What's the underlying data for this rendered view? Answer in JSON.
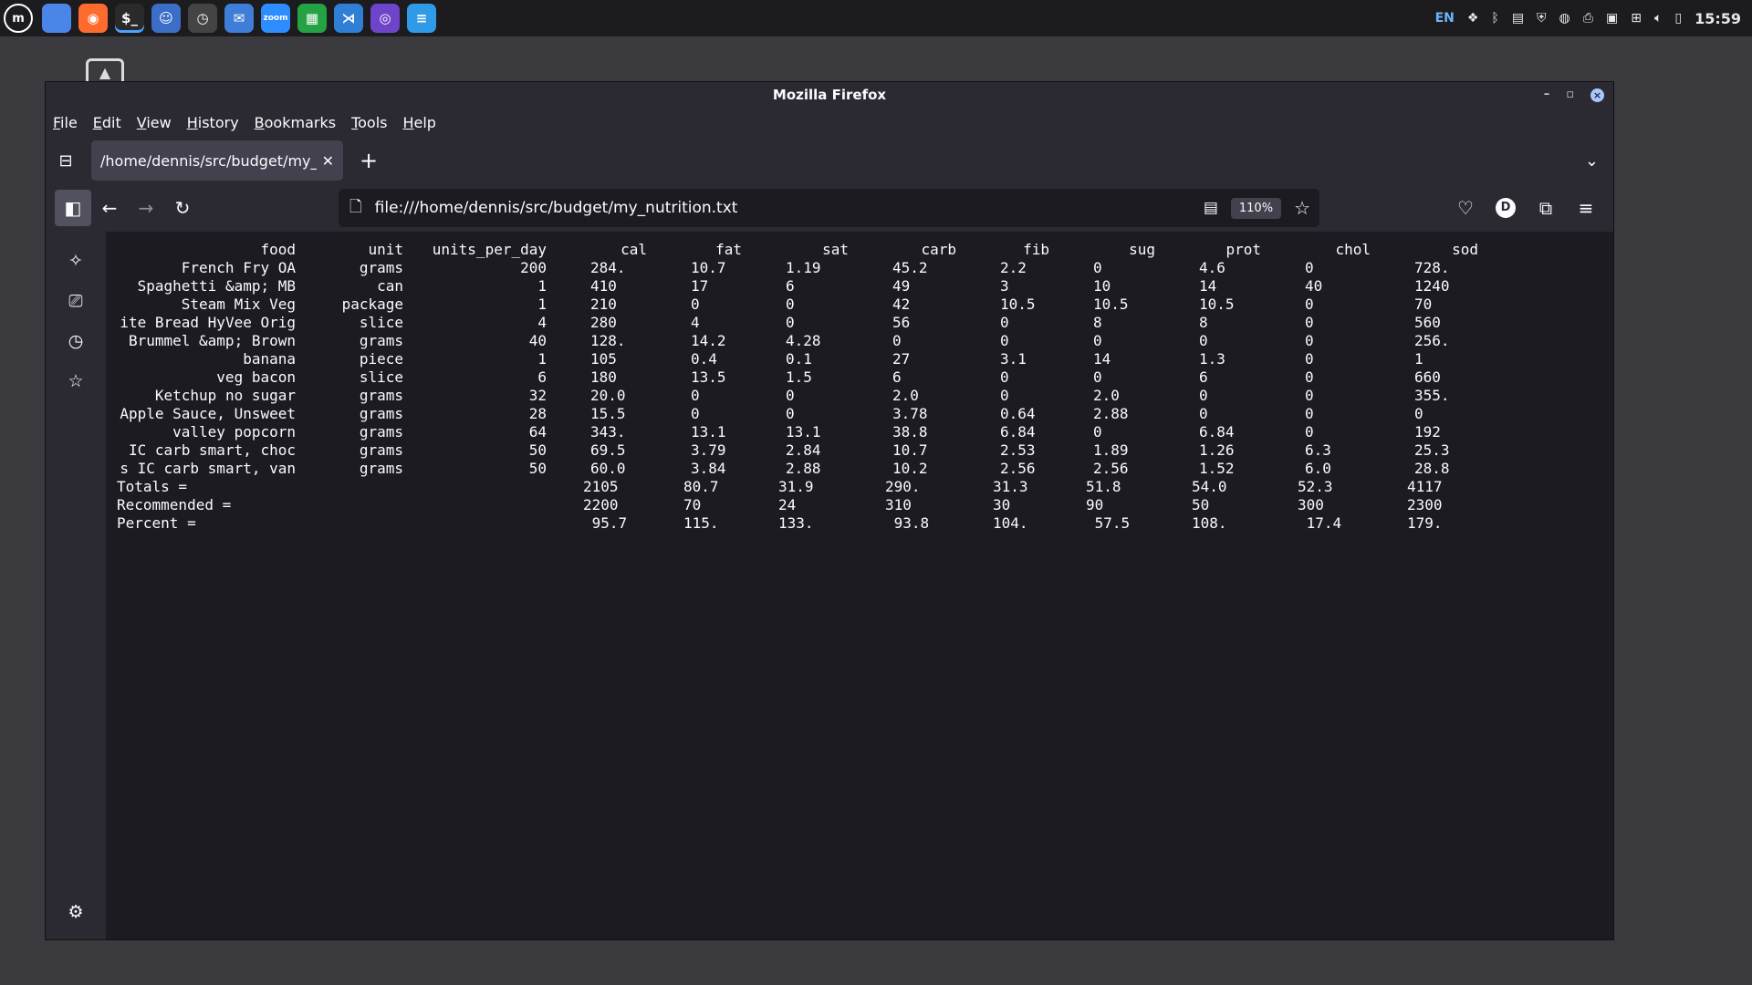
{
  "panel": {
    "menu_logo": "m",
    "launchers": [
      {
        "name": "files-icon",
        "color": "#4a86e8",
        "glyph": ""
      },
      {
        "name": "firefox-icon",
        "color": "#ff6b2d",
        "glyph": "◉"
      },
      {
        "name": "terminal-icon",
        "color": "#2a2a2a",
        "glyph": "$_"
      },
      {
        "name": "finder-icon",
        "color": "#3c6ec8",
        "glyph": "☺"
      },
      {
        "name": "timeshift-icon",
        "color": "#444444",
        "glyph": "◷"
      },
      {
        "name": "mail-icon",
        "color": "#3f7ed8",
        "glyph": "✉"
      },
      {
        "name": "zoom-icon",
        "color": "#2d8cff",
        "glyph": "zoom"
      },
      {
        "name": "spreadsheet-icon",
        "color": "#25a244",
        "glyph": "▦"
      },
      {
        "name": "vscode-icon",
        "color": "#2f7fd6",
        "glyph": "⋊"
      },
      {
        "name": "github-icon",
        "color": "#6e44c8",
        "glyph": "◎"
      },
      {
        "name": "text-editor-icon",
        "color": "#2f9be8",
        "glyph": "≡"
      }
    ],
    "tray": {
      "language": "EN",
      "clock": "15:59"
    }
  },
  "window": {
    "title": "Mozilla Firefox",
    "menu": [
      {
        "mnemonic": "F",
        "rest": "ile"
      },
      {
        "mnemonic": "E",
        "rest": "dit"
      },
      {
        "mnemonic": "V",
        "rest": "iew"
      },
      {
        "mnemonic": "H",
        "rest": "istory"
      },
      {
        "mnemonic": "B",
        "rest": "ookmarks"
      },
      {
        "mnemonic": "T",
        "rest": "ools"
      },
      {
        "mnemonic": "H",
        "rest": "elp"
      }
    ],
    "tab": {
      "title": "/home/dennis/src/budget/my_nutrition.txt"
    },
    "url": "file:///home/dennis/src/budget/my_nutrition.txt",
    "zoom": "110%",
    "avatar_letter": "D"
  },
  "nutrition": {
    "headers": [
      "food",
      "unit",
      "units_per_day",
      "cal",
      "fat",
      "sat",
      "carb",
      "fib",
      "sug",
      "prot",
      "chol",
      "sod"
    ],
    "rows": [
      [
        "French Fry OA",
        "grams",
        "200",
        "284.",
        "10.7",
        "1.19",
        "45.2",
        "2.2",
        "0",
        "4.6",
        "0",
        "728."
      ],
      [
        "Spaghetti &amp; MB",
        "can",
        "1",
        "410",
        "17",
        "6",
        "49",
        "3",
        "10",
        "14",
        "40",
        "1240"
      ],
      [
        "Steam Mix Veg",
        "package",
        "1",
        "210",
        "0",
        "0",
        "42",
        "10.5",
        "10.5",
        "10.5",
        "0",
        "70"
      ],
      [
        "ite Bread HyVee Orig",
        "slice",
        "4",
        "280",
        "4",
        "0",
        "56",
        "0",
        "8",
        "8",
        "0",
        "560"
      ],
      [
        "Brummel &amp; Brown",
        "grams",
        "40",
        "128.",
        "14.2",
        "4.28",
        "0",
        "0",
        "0",
        "0",
        "0",
        "256."
      ],
      [
        "banana",
        "piece",
        "1",
        "105",
        "0.4",
        "0.1",
        "27",
        "3.1",
        "14",
        "1.3",
        "0",
        "1"
      ],
      [
        "veg bacon",
        "slice",
        "6",
        "180",
        "13.5",
        "1.5",
        "6",
        "0",
        "0",
        "6",
        "0",
        "660"
      ],
      [
        "Ketchup no sugar",
        "grams",
        "32",
        "20.0",
        "0",
        "0",
        "2.0",
        "0",
        "2.0",
        "0",
        "0",
        "355."
      ],
      [
        "Apple Sauce, Unsweet",
        "grams",
        "28",
        "15.5",
        "0",
        "0",
        "3.78",
        "0.64",
        "2.88",
        "0",
        "0",
        "0"
      ],
      [
        "valley popcorn",
        "grams",
        "64",
        "343.",
        "13.1",
        "13.1",
        "38.8",
        "6.84",
        "0",
        "6.84",
        "0",
        "192"
      ],
      [
        "IC carb smart, choc",
        "grams",
        "50",
        "69.5",
        "3.79",
        "2.84",
        "10.7",
        "2.53",
        "1.89",
        "1.26",
        "6.3",
        "25.3"
      ],
      [
        "s IC carb smart, van",
        "grams",
        "50",
        "60.0",
        "3.84",
        "2.88",
        "10.2",
        "2.56",
        "2.56",
        "1.52",
        "6.0",
        "28.8"
      ]
    ],
    "summary": [
      {
        "label": "Totals =",
        "values": [
          "2105",
          "80.7",
          "31.9",
          "290.",
          "31.3",
          "51.8",
          "54.0",
          "52.3",
          "4117"
        ]
      },
      {
        "label": "Recommended =",
        "values": [
          "2200",
          "70",
          "24",
          "310",
          "30",
          "90",
          "50",
          "300",
          "2300"
        ]
      },
      {
        "label": "Percent =",
        "values": [
          " 95.7",
          "115.",
          "133.",
          " 93.8",
          "104.",
          " 57.5",
          "108.",
          " 17.4",
          "179."
        ]
      }
    ]
  }
}
